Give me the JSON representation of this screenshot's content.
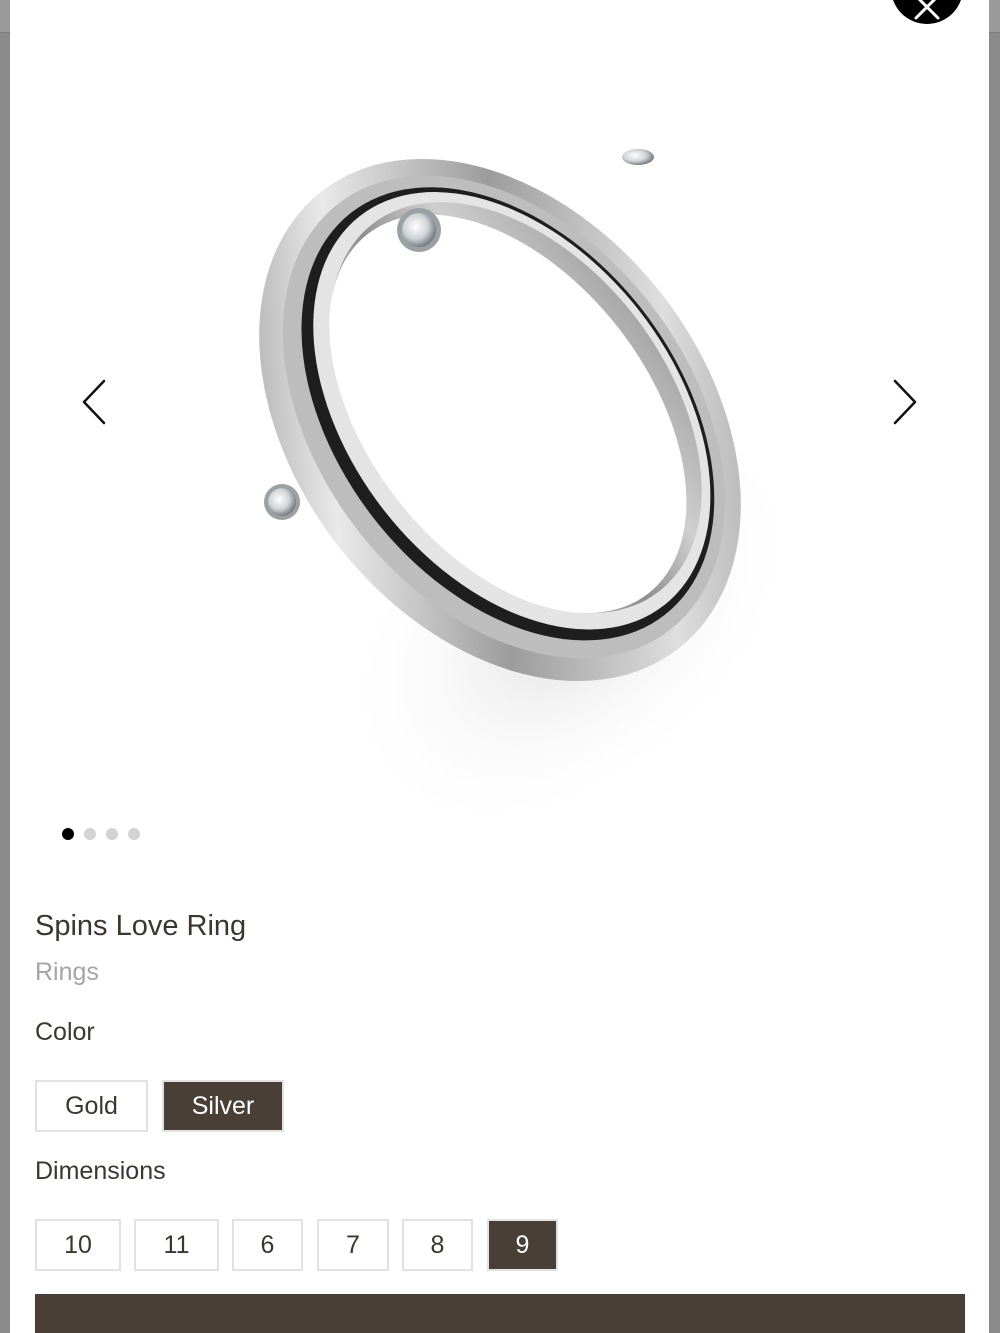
{
  "product": {
    "title": "Spins Love Ring",
    "category": "Rings"
  },
  "gallery": {
    "image_count": 4,
    "active_index": 0
  },
  "options": {
    "color": {
      "label": "Color",
      "values": [
        "Gold",
        "Silver"
      ],
      "selected": "Silver"
    },
    "dimensions": {
      "label": "Dimensions",
      "values": [
        "10",
        "11",
        "6",
        "7",
        "8",
        "9"
      ],
      "selected": "9"
    }
  },
  "colors": {
    "accent": "#4a3f36",
    "text": "#3b3632",
    "muted": "#a5a5a5",
    "border": "#e2e2e2"
  },
  "icons": {
    "close": "close-icon",
    "prev": "chevron-left-icon",
    "next": "chevron-right-icon"
  }
}
